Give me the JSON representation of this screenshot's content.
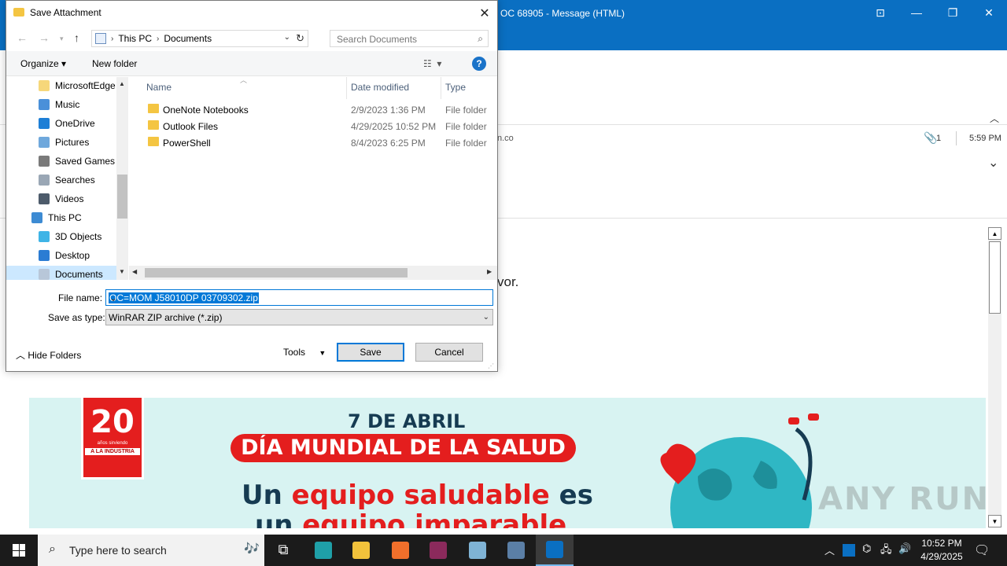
{
  "outlook": {
    "title": "OC 68905  -  Message (HTML)",
    "sender_tail": "n.co",
    "attachment_count": "1",
    "time": "5:59 PM",
    "body_fragment": "vor."
  },
  "banner": {
    "badge_number": "20",
    "badge_sub": "años sirviendo",
    "badge_ribbon": "A LA INDUSTRIA",
    "date": "7 DE ABRIL",
    "headline": "DÍA MUNDIAL DE LA SALUD",
    "slogan1_a": "Un ",
    "slogan1_b": "equipo saludable",
    "slogan1_c": " es",
    "slogan2_a": "un ",
    "slogan2_b": "equipo imparable",
    "watermark": "ANY RUN"
  },
  "dialog": {
    "title": "Save Attachment",
    "address": [
      "This PC",
      "Documents"
    ],
    "search_placeholder": "Search Documents",
    "organize": "Organize ▾",
    "new_folder": "New folder",
    "tree": [
      {
        "label": "MicrosoftEdge",
        "color": "#f6d77a"
      },
      {
        "label": "Music",
        "color": "#4a90d9"
      },
      {
        "label": "OneDrive",
        "color": "#1e7fd6"
      },
      {
        "label": "Pictures",
        "color": "#6fa8dc"
      },
      {
        "label": "Saved Games",
        "color": "#7a7a7a"
      },
      {
        "label": "Searches",
        "color": "#9aa7b5"
      },
      {
        "label": "Videos",
        "color": "#4d5b6b"
      },
      {
        "label": "This PC",
        "color": "#3d8bd3"
      },
      {
        "label": "3D Objects",
        "color": "#3fb4e6"
      },
      {
        "label": "Desktop",
        "color": "#2b7cd3"
      },
      {
        "label": "Documents",
        "color": "#b8c7d9"
      }
    ],
    "columns": {
      "name": "Name",
      "date": "Date modified",
      "type": "Type"
    },
    "files": [
      {
        "name": "OneNote Notebooks",
        "date": "2/9/2023 1:36 PM",
        "type": "File folder"
      },
      {
        "name": "Outlook Files",
        "date": "4/29/2025 10:52 PM",
        "type": "File folder"
      },
      {
        "name": "PowerShell",
        "date": "8/4/2023 6:25 PM",
        "type": "File folder"
      }
    ],
    "filename_label": "File name:",
    "filename_value": "OC=MOM J58010DP 03709302.zip",
    "savetype_label": "Save as type:",
    "savetype_value": "WinRAR ZIP archive (*.zip)",
    "hide_folders": "Hide Folders",
    "tools": "Tools",
    "save": "Save",
    "cancel": "Cancel"
  },
  "taskbar": {
    "search_text": "Type here to search",
    "apps": [
      {
        "name": "task-view",
        "color": "#1b1b1b"
      },
      {
        "name": "edge",
        "color": "#1fa0a8"
      },
      {
        "name": "file-explorer",
        "color": "#f2c23b"
      },
      {
        "name": "firefox",
        "color": "#f06f2b"
      },
      {
        "name": "winrar",
        "color": "#8b2a5c"
      },
      {
        "name": "notepad-app",
        "color": "#7fb3d5"
      },
      {
        "name": "remote-app",
        "color": "#5b7fa6"
      },
      {
        "name": "outlook",
        "color": "#0a6fc2"
      }
    ],
    "time": "10:52 PM",
    "date": "4/29/2025"
  }
}
